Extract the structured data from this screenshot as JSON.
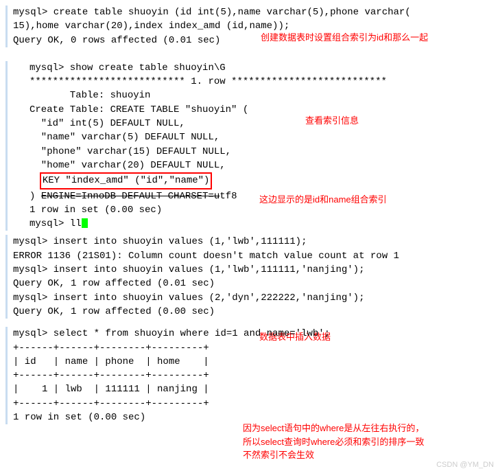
{
  "block1": {
    "l1": "mysql> create table shuoyin (id int(5),name varchar(5),phone varchar(",
    "l2": "15),home varchar(20),index index_amd (id,name));",
    "l3": "Query OK, 0 rows affected (0.01 sec)"
  },
  "ann1": "创建数据表时设置组合索引为id和那么一起",
  "block2": {
    "l1": "mysql> show create table shuoyin\\G",
    "l2": "*************************** 1. row ***************************",
    "l3": "       Table: shuoyin",
    "l4": "Create Table: CREATE TABLE \"shuoyin\" (",
    "l5": "  \"id\" int(5) DEFAULT NULL,",
    "l6": "  \"name\" varchar(5) DEFAULT NULL,",
    "l7": "  \"phone\" varchar(15) DEFAULT NULL,",
    "l8a": "  \"home\" varchar(20) DEFAULT NULL,",
    "keyline_prefix": "  ",
    "keyline": "KEY \"index_amd\" (\"id\",\"name\")",
    "l10a": ") ",
    "l10b": "ENGINE=InnoDB DEFAULT CHARSET=u",
    "l10c": "tf8",
    "l11": "1 row in set (0.00 sec)",
    "l12": "",
    "l13": "mysql> ll"
  },
  "ann2": "查看索引信息",
  "ann3": "这边显示的是id和name组合索引",
  "block3": {
    "l1": "mysql> insert into shuoyin values (1,'lwb',111111);",
    "l2": "ERROR 1136 (21S01): Column count doesn't match value count at row 1",
    "l3": "mysql> insert into shuoyin values (1,'lwb',111111,'nanjing');",
    "l4": "Query OK, 1 row affected (0.01 sec)",
    "l5": "",
    "l6": "mysql> insert into shuoyin values (2,'dyn',222222,'nanjing');",
    "l7": "Query OK, 1 row affected (0.00 sec)"
  },
  "ann4": "数据表中插入数据",
  "block4": {
    "l1": "mysql> select * from shuoyin where id=1 and name='lwb';",
    "l2": "+------+------+--------+---------+",
    "l3": "| id   | name | phone  | home    |",
    "l4": "+------+------+--------+---------+",
    "l5": "|    1 | lwb  | 111111 | nanjing |",
    "l6": "+------+------+--------+---------+",
    "l7": "1 row in set (0.00 sec)"
  },
  "ann5a": "因为select语句中的where是从左往右执行的，",
  "ann5b": "所以select查询时where必须和索引的排序一致",
  "ann5c": "不然索引不会生效",
  "watermark": "CSDN @YM_DN"
}
